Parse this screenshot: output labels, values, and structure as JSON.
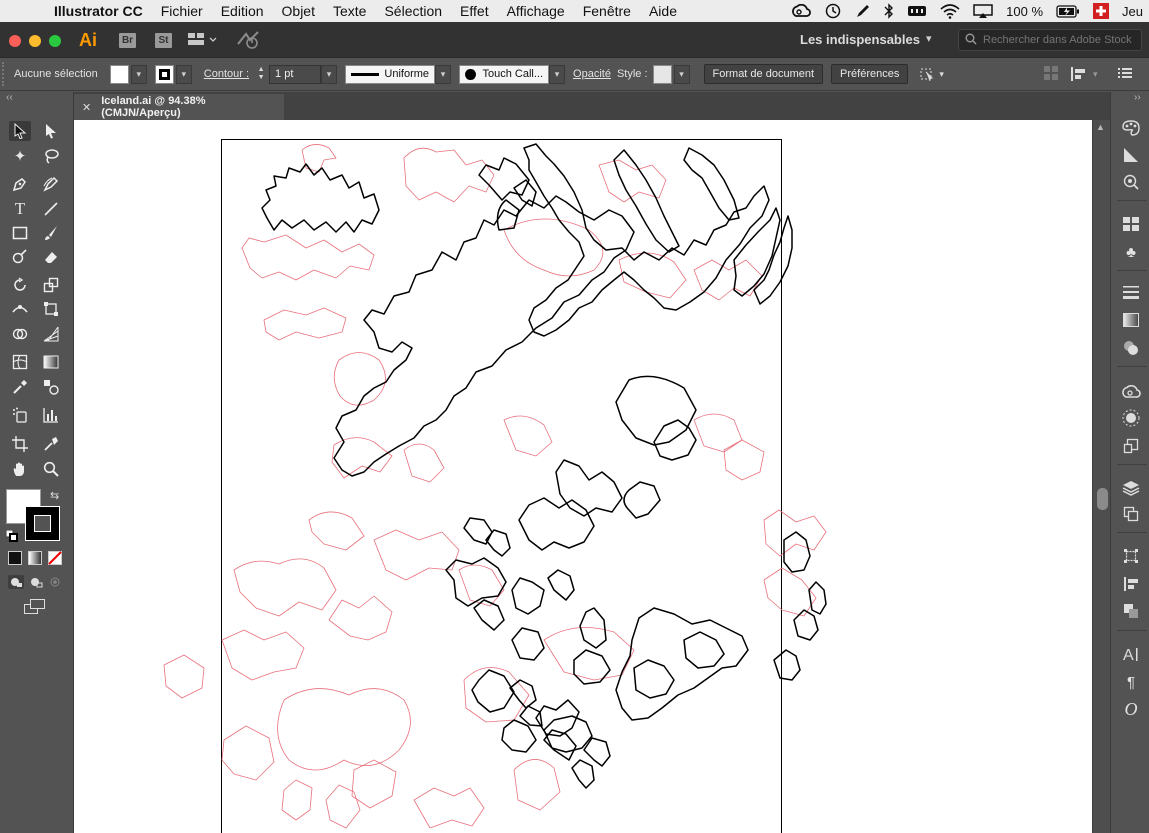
{
  "menubar": {
    "apple_icon": "apple-logo-icon",
    "app_name": "Illustrator CC",
    "items": [
      "Fichier",
      "Edition",
      "Objet",
      "Texte",
      "Sélection",
      "Effet",
      "Affichage",
      "Fenêtre",
      "Aide"
    ],
    "battery_percent": "100 %",
    "clock_partial": "Jeu"
  },
  "appbar": {
    "logo": "Ai",
    "bridge_label": "Br",
    "stock_label": "St",
    "workspace_label": "Les indispensables",
    "search_placeholder": "Rechercher dans Adobe Stock"
  },
  "controlbar": {
    "selection_status": "Aucune sélection",
    "stroke_label": "Contour :",
    "stroke_weight": "1 pt",
    "stroke_profile": "Uniforme",
    "brush_name": "Touch Call...",
    "opacity_label": "Opacité",
    "style_label": "Style :",
    "document_setup_button": "Format de document",
    "preferences_button": "Préférences"
  },
  "document": {
    "tab_title": "Iceland.ai @ 94.38% (CMJN/Aperçu)"
  },
  "colors": {
    "accent_ai": "#ff9a00",
    "map_red": "#e8707c",
    "map_black": "#000000"
  }
}
